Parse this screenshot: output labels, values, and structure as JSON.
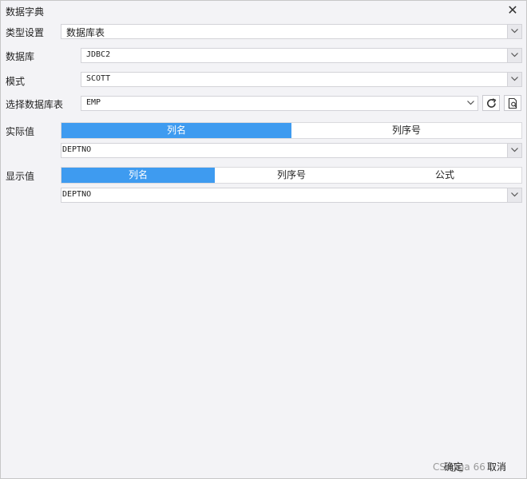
{
  "dialog": {
    "title": "数据字典",
    "close_icon": "✕"
  },
  "type_setting": {
    "label": "类型设置",
    "value": "数据库表"
  },
  "database": {
    "label": "数据库",
    "value": "JDBC2"
  },
  "schema": {
    "label": "模式",
    "value": "SCOTT"
  },
  "table": {
    "label": "选择数据库表",
    "value": "EMP"
  },
  "actual_value": {
    "label": "实际值",
    "tabs": [
      "列名",
      "列序号"
    ],
    "active_tab": "列名",
    "value": "DEPTNO"
  },
  "display_value": {
    "label": "显示值",
    "tabs": [
      "列名",
      "列序号",
      "公式"
    ],
    "active_tab": "列名",
    "value": "DEPTNO"
  },
  "footer": {
    "ok": "确定",
    "cancel": "取消",
    "watermark": "CS         @ga          66"
  },
  "colors": {
    "accent": "#3e9bf0",
    "background": "#f3f3f6"
  }
}
